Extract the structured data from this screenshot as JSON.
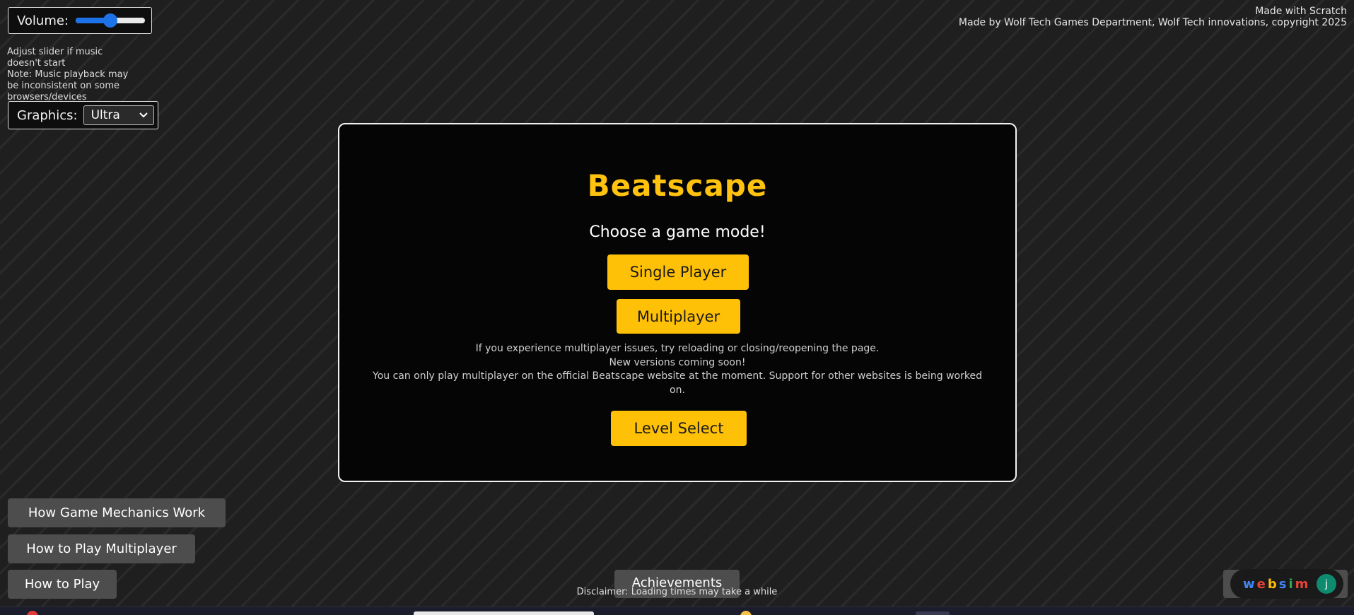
{
  "volume": {
    "label": "Volume:",
    "level": 0.5
  },
  "music_note": "Adjust slider if music doesn't start\nNote: Music playback may be inconsistent on some browsers/devices",
  "graphics": {
    "label": "Graphics:",
    "selected": "Ultra"
  },
  "credits": {
    "line1": "Made with Scratch",
    "line2": "Made by Wolf Tech Games Department, Wolf Tech innovations, copyright 2025"
  },
  "panel": {
    "title": "Beatscape",
    "subtitle": "Choose a game mode!",
    "single_player_label": "Single Player",
    "multiplayer_label": "Multiplayer",
    "info_line1": "If you experience multiplayer issues, try reloading or closing/reopening the page.",
    "info_line2": "New versions coming soon!",
    "info_line3": "You can only play multiplayer on the official Beatscape website at the moment. Support for other websites is being worked on.",
    "level_select_label": "Level Select"
  },
  "bottom": {
    "mechanics_label": "How Game Mechanics Work",
    "how_multiplayer_label": "How to Play Multiplayer",
    "how_to_play_label": "How to Play",
    "achievements_label": "Achievements",
    "disclaimer": "Disclaimer: Loading times may take a while"
  },
  "websim": {
    "logo_letters": [
      "w",
      "e",
      "b",
      "s",
      "i",
      "m"
    ],
    "logo_colors": [
      "#4285f4",
      "#ea4335",
      "#fbbc05",
      "#4285f4",
      "#34a853",
      "#ea4335"
    ],
    "avatar_letter": "j"
  },
  "colors": {
    "accent": "#ffc107",
    "title": "#ffc20e",
    "slider": "#1d72e8"
  },
  "icons": {
    "graphics_dropdown": "chevron-down-icon"
  }
}
